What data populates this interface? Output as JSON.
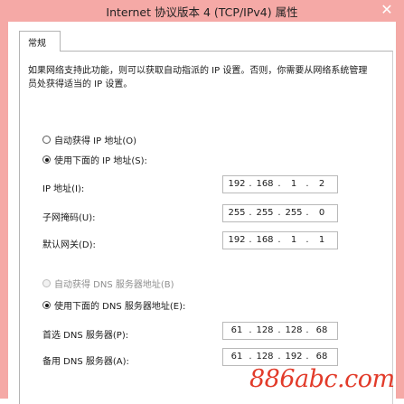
{
  "window": {
    "title": "Internet 协议版本 4 (TCP/IPv4) 属性",
    "close_glyph": "✕"
  },
  "tabs": [
    {
      "label": "常规"
    }
  ],
  "description": "如果网络支持此功能，则可以获取自动指派的 IP 设置。否则，你需要从网络系统管理员处获得适当的 IP 设置。",
  "ip_mode": {
    "auto_label": "自动获得 IP 地址(O)",
    "manual_label": "使用下面的 IP 地址(S):",
    "selected": "manual"
  },
  "ip_fields": [
    {
      "label": "IP 地址(I):",
      "octets": [
        "192",
        "168",
        "1",
        "2"
      ]
    },
    {
      "label": "子网掩码(U):",
      "octets": [
        "255",
        "255",
        "255",
        "0"
      ]
    },
    {
      "label": "默认网关(D):",
      "octets": [
        "192",
        "168",
        "1",
        "1"
      ]
    }
  ],
  "dns_mode": {
    "auto_label": "自动获得 DNS 服务器地址(B)",
    "manual_label": "使用下面的 DNS 服务器地址(E):",
    "selected": "manual",
    "auto_disabled": true
  },
  "dns_fields": [
    {
      "label": "首选 DNS 服务器(P):",
      "octets": [
        "61",
        "128",
        "128",
        "68"
      ]
    },
    {
      "label": "备用 DNS 服务器(A):",
      "octets": [
        "61",
        "128",
        "192",
        "68"
      ]
    }
  ],
  "watermark": "886abc.com",
  "colors": {
    "frame": "#f5a9a6",
    "watermark": "#e23b2a"
  }
}
